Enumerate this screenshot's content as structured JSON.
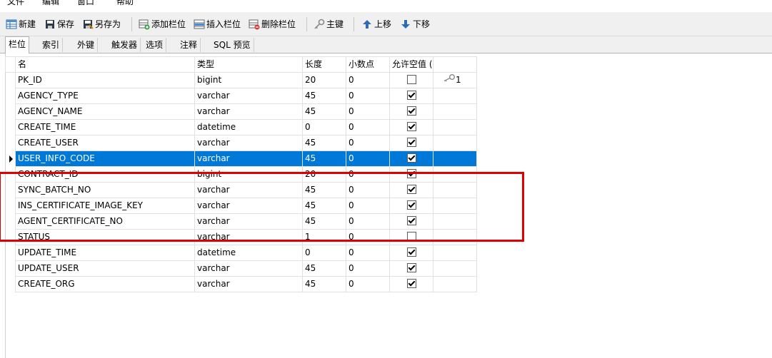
{
  "menu": {
    "items": [
      "文件",
      "编辑",
      "窗口",
      "帮助"
    ]
  },
  "toolbar": {
    "new_label": "新建",
    "save_label": "保存",
    "saveas_label": "另存为",
    "add_column_label": "添加栏位",
    "insert_column_label": "插入栏位",
    "delete_column_label": "删除栏位",
    "primary_key_label": "主键",
    "move_up_label": "上移",
    "move_down_label": "下移"
  },
  "tabs": [
    "栏位",
    "索引",
    "外键",
    "触发器",
    "选项",
    "注释",
    "SQL 预览"
  ],
  "active_tab": "栏位",
  "grid": {
    "headers": [
      "名",
      "类型",
      "长度",
      "小数点",
      "允许空值 (",
      ""
    ],
    "rows": [
      {
        "name": "PK_ID",
        "type": "bigint",
        "length": "20",
        "decimals": "0",
        "nullable": false,
        "key": "1"
      },
      {
        "name": "AGENCY_TYPE",
        "type": "varchar",
        "length": "45",
        "decimals": "0",
        "nullable": true,
        "key": ""
      },
      {
        "name": "AGENCY_NAME",
        "type": "varchar",
        "length": "45",
        "decimals": "0",
        "nullable": true,
        "key": ""
      },
      {
        "name": "CREATE_TIME",
        "type": "datetime",
        "length": "0",
        "decimals": "0",
        "nullable": true,
        "key": ""
      },
      {
        "name": "CREATE_USER",
        "type": "varchar",
        "length": "45",
        "decimals": "0",
        "nullable": true,
        "key": ""
      },
      {
        "name": "USER_INFO_CODE",
        "type": "varchar",
        "length": "45",
        "decimals": "0",
        "nullable": true,
        "key": ""
      },
      {
        "name": "CONTRACT_ID",
        "type": "bigint",
        "length": "20",
        "decimals": "0",
        "nullable": true,
        "key": ""
      },
      {
        "name": "SYNC_BATCH_NO",
        "type": "varchar",
        "length": "45",
        "decimals": "0",
        "nullable": true,
        "key": ""
      },
      {
        "name": "INS_CERTIFICATE_IMAGE_KEY",
        "type": "varchar",
        "length": "45",
        "decimals": "0",
        "nullable": true,
        "key": ""
      },
      {
        "name": "AGENT_CERTIFICATE_NO",
        "type": "varchar",
        "length": "45",
        "decimals": "0",
        "nullable": true,
        "key": ""
      },
      {
        "name": "STATUS",
        "type": "varchar",
        "length": "1",
        "decimals": "0",
        "nullable": false,
        "key": ""
      },
      {
        "name": "UPDATE_TIME",
        "type": "datetime",
        "length": "0",
        "decimals": "0",
        "nullable": true,
        "key": ""
      },
      {
        "name": "UPDATE_USER",
        "type": "varchar",
        "length": "45",
        "decimals": "0",
        "nullable": true,
        "key": ""
      },
      {
        "name": "CREATE_ORG",
        "type": "varchar",
        "length": "45",
        "decimals": "0",
        "nullable": true,
        "key": ""
      }
    ],
    "selected_row": 5
  },
  "annotation": {
    "highlight_color": "#e00000",
    "selection_color": "#0078d7"
  }
}
